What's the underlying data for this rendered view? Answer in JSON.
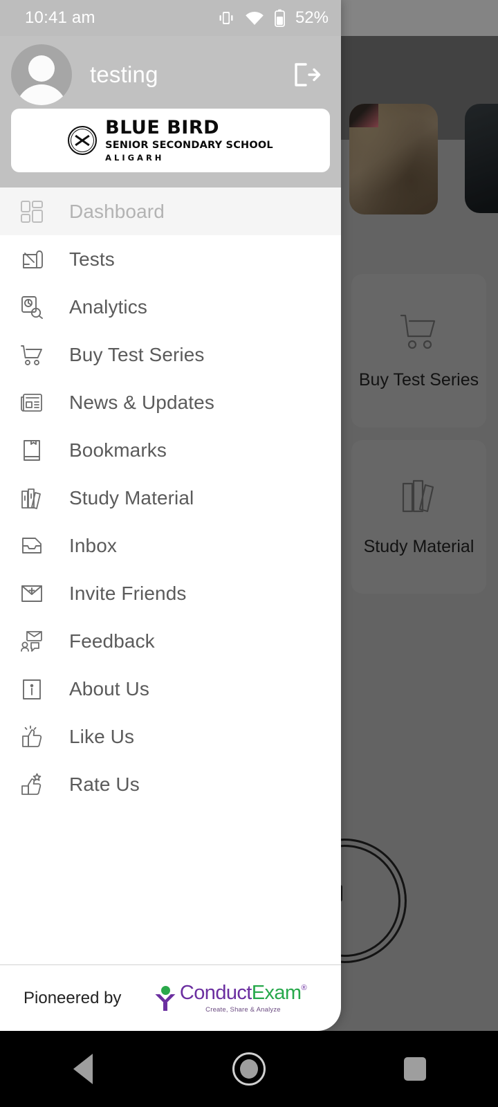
{
  "status_bar": {
    "time": "10:41 am",
    "battery_percent": "52%",
    "icons": [
      "vibrate-icon",
      "wifi-icon",
      "battery-icon"
    ]
  },
  "drawer": {
    "profile": {
      "username": "testing",
      "avatar": "person-avatar",
      "logout": "logout-icon"
    },
    "school": {
      "name": "BLUE BIRD",
      "subtitle": "SENIOR SECONDARY SCHOOL",
      "city": "ALIGARH",
      "seal": "school-seal-icon"
    },
    "menu": [
      {
        "label": "Dashboard",
        "icon": "dashboard-icon",
        "selected": true
      },
      {
        "label": "Tests",
        "icon": "test-paper-icon",
        "selected": false
      },
      {
        "label": "Analytics",
        "icon": "analytics-icon",
        "selected": false
      },
      {
        "label": "Buy Test Series",
        "icon": "cart-icon",
        "selected": false
      },
      {
        "label": "News & Updates",
        "icon": "newspaper-icon",
        "selected": false
      },
      {
        "label": "Bookmarks",
        "icon": "bookmark-icon",
        "selected": false
      },
      {
        "label": "Study Material",
        "icon": "books-icon",
        "selected": false
      },
      {
        "label": "Inbox",
        "icon": "inbox-tray-icon",
        "selected": false
      },
      {
        "label": "Invite Friends",
        "icon": "envelope-plus-icon",
        "selected": false
      },
      {
        "label": "Feedback",
        "icon": "feedback-chat-icon",
        "selected": false
      },
      {
        "label": "About Us",
        "icon": "info-box-icon",
        "selected": false
      },
      {
        "label": "Like Us",
        "icon": "thumbs-up-icon",
        "selected": false
      },
      {
        "label": "Rate Us",
        "icon": "thumbs-up-star-icon",
        "selected": false
      }
    ],
    "footer": {
      "text": "Pioneered by",
      "brand_first": "Conduct",
      "brand_second": "Exam",
      "brand_registered": "®",
      "brand_tagline": "Create, Share & Analyze"
    }
  },
  "background": {
    "tiles": [
      {
        "label": "Buy Test Series",
        "icon": "cart-icon"
      },
      {
        "label": "Study Material",
        "icon": "books-icon"
      }
    ]
  },
  "navigation_bar": {
    "back": "back-triangle-icon",
    "home": "home-circle-icon",
    "recents": "recents-square-icon"
  },
  "colors": {
    "drawer_header": "#c1c1c1",
    "selected_row": "#f5f5f5",
    "brand_purple": "#6b2fa0",
    "brand_green": "#27a84b",
    "scrim": "rgba(0,0,0,0.30)"
  }
}
